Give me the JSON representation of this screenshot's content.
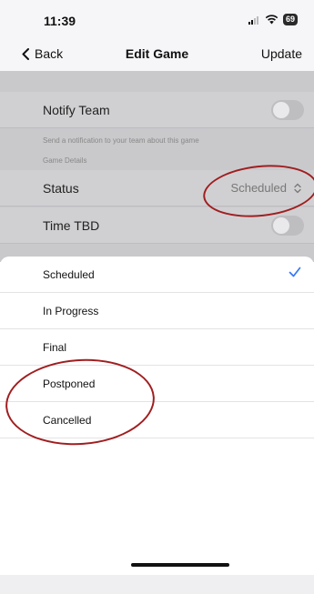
{
  "status_bar": {
    "time": "11:39",
    "battery": "69"
  },
  "nav": {
    "back_label": "Back",
    "title": "Edit Game",
    "update_label": "Update"
  },
  "form": {
    "notify_label": "Notify Team",
    "notify_caption": "Send a notification to your team about this game",
    "section_caption": "Game Details",
    "status_label": "Status",
    "status_value": "Scheduled",
    "time_tbd_label": "Time TBD",
    "notify_on": false,
    "time_tbd_on": false
  },
  "picker": {
    "options": [
      "Scheduled",
      "In Progress",
      "Final",
      "Postponed",
      "Cancelled"
    ],
    "selected": "Scheduled"
  },
  "colors": {
    "checkmark": "#3478f6",
    "annotation": "#a01e20"
  }
}
